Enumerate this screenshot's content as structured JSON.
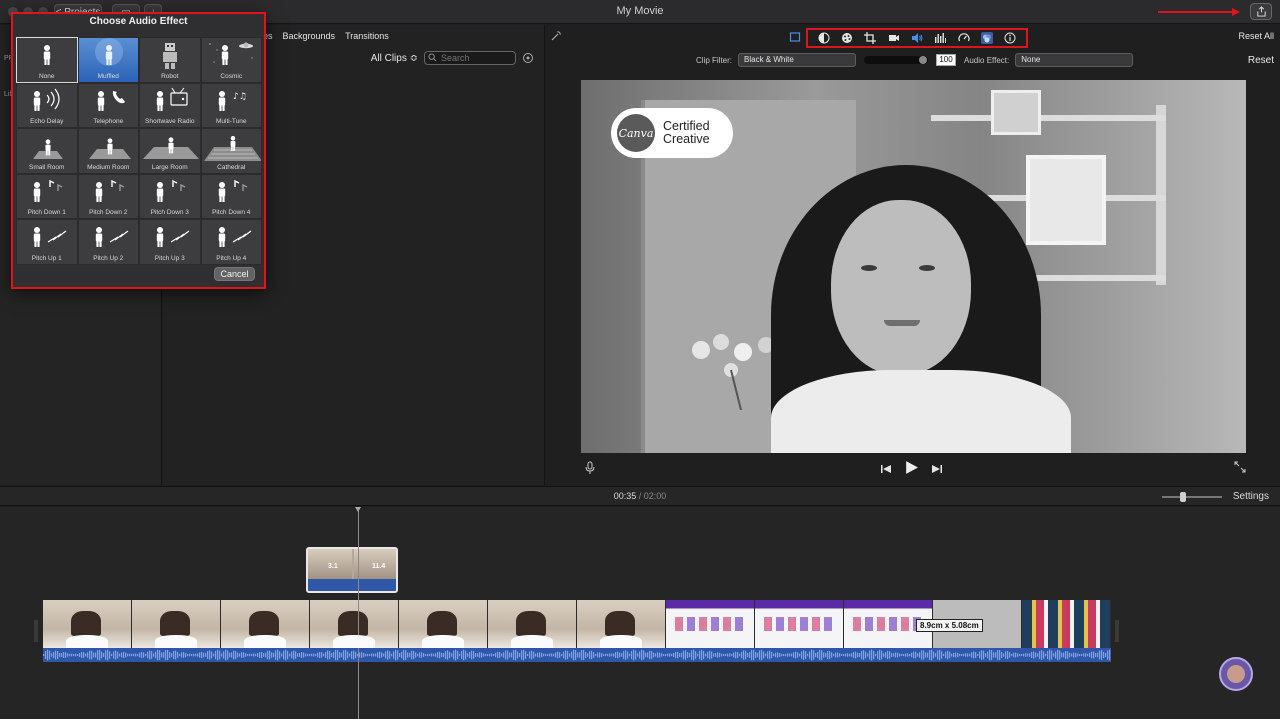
{
  "window": {
    "title": "My Movie",
    "projects_label": "< Projects"
  },
  "browser": {
    "tabs": [
      "es",
      "Backgrounds",
      "Transitions"
    ],
    "clip_scope": "All Clips ≎",
    "search": {
      "placeholder": "Search",
      "value": ""
    },
    "library_labels": [
      "PR",
      "Lib"
    ]
  },
  "viewer": {
    "reset_all_label": "Reset All",
    "reset_label": "Reset",
    "clip_filter_label": "Clip Filter:",
    "clip_filter_value": "Black & White",
    "filter_amount": "100",
    "audio_effect_label": "Audio Effect:",
    "audio_effect_value": "None",
    "toolbar_icons": [
      "color-balance-icon",
      "color-correction-icon",
      "crop-icon",
      "stabilization-icon",
      "volume-icon",
      "equalizer-icon",
      "speed-icon",
      "clip-filter-icon",
      "info-icon"
    ],
    "overlay_badge": {
      "logo": "Canva",
      "line1": "Certified",
      "line2": "Creative"
    }
  },
  "timeline": {
    "current_time": "00:35",
    "separator": "/",
    "duration": "02:00",
    "settings_label": "Settings",
    "dimension_label": "8.9cm x 5.08cm",
    "overlay_caption_left": "3.1",
    "overlay_caption_right": "11.4",
    "zoom_level": 0.3
  },
  "audio_effect_dialog": {
    "title": "Choose Audio Effect",
    "cancel_label": "Cancel",
    "effects": [
      {
        "label": "None",
        "icon": "none"
      },
      {
        "label": "Muffled",
        "icon": "muffled"
      },
      {
        "label": "Robot",
        "icon": "robot"
      },
      {
        "label": "Cosmic",
        "icon": "cosmic"
      },
      {
        "label": "Echo Delay",
        "icon": "echo"
      },
      {
        "label": "Telephone",
        "icon": "telephone"
      },
      {
        "label": "Shortwave Radio",
        "icon": "radio"
      },
      {
        "label": "Multi-Tune",
        "icon": "multitune"
      },
      {
        "label": "Small Room",
        "icon": "room-small"
      },
      {
        "label": "Medium Room",
        "icon": "room-medium"
      },
      {
        "label": "Large Room",
        "icon": "room-large"
      },
      {
        "label": "Cathedral",
        "icon": "cathedral"
      },
      {
        "label": "Pitch Down 1",
        "icon": "pitch-down"
      },
      {
        "label": "Pitch Down 2",
        "icon": "pitch-down"
      },
      {
        "label": "Pitch Down 3",
        "icon": "pitch-down"
      },
      {
        "label": "Pitch Down 4",
        "icon": "pitch-down"
      },
      {
        "label": "Pitch Up 1",
        "icon": "pitch-up"
      },
      {
        "label": "Pitch Up 2",
        "icon": "pitch-up"
      },
      {
        "label": "Pitch Up 3",
        "icon": "pitch-up"
      },
      {
        "label": "Pitch Up 4",
        "icon": "pitch-up"
      }
    ],
    "selected": "None",
    "hovered": "Muffled"
  },
  "colors": {
    "highlight_red": "#e0141c",
    "hover_blue": "#2c63b8",
    "audio_wave": "#2f57a9"
  }
}
